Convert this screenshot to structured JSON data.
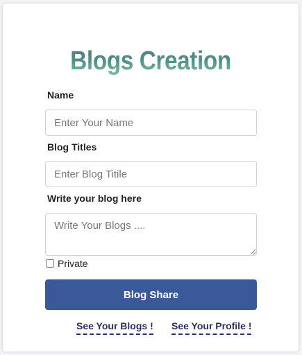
{
  "form": {
    "title": "Blogs Creation",
    "name_label": "Name",
    "name_placeholder": "Enter Your Name",
    "blog_titles_label": "Blog Titles",
    "blog_title_placeholder": "Enter Blog Titile",
    "blog_body_label": "Write your blog here",
    "blog_body_placeholder": "Write Your Blogs ....",
    "private_label": "Private",
    "private_checked": false,
    "submit_label": "Blog Share"
  },
  "links": {
    "see_blogs": "See Your Blogs !",
    "see_profile": "See Your Profile !"
  },
  "colors": {
    "button_bg": "#3b5998",
    "link_color": "#2c2f63",
    "title_gradient_top": "#4f7b8a",
    "title_gradient_bottom": "#7fbf9e"
  }
}
